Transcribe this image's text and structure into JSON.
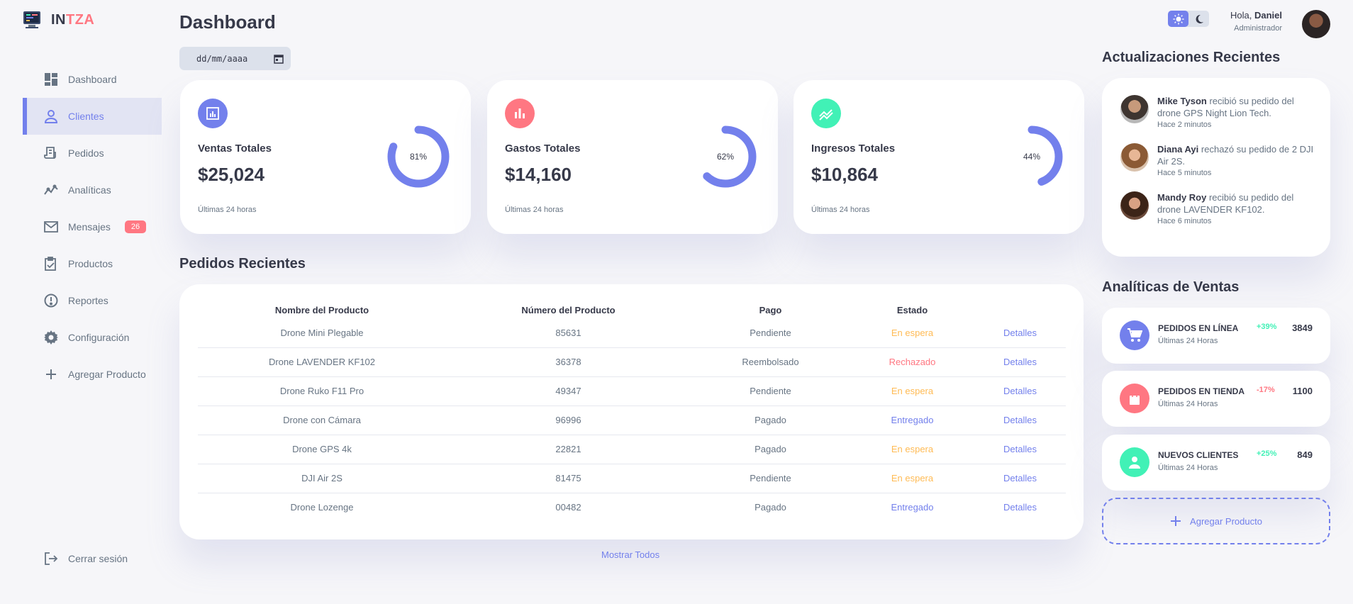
{
  "brand": {
    "prefix": "IN",
    "accent": "TZA"
  },
  "sidebar": {
    "items": [
      {
        "label": "Dashboard",
        "icon": "grid-icon",
        "active": false
      },
      {
        "label": "Clientes",
        "icon": "person-icon",
        "active": true
      },
      {
        "label": "Pedidos",
        "icon": "receipt-icon",
        "active": false
      },
      {
        "label": "Analíticas",
        "icon": "analytics-icon",
        "active": false
      },
      {
        "label": "Mensajes",
        "icon": "mail-icon",
        "active": false,
        "badge": "26"
      },
      {
        "label": "Productos",
        "icon": "inventory-icon",
        "active": false
      },
      {
        "label": "Reportes",
        "icon": "report-icon",
        "active": false
      },
      {
        "label": "Configuración",
        "icon": "gear-icon",
        "active": false
      },
      {
        "label": "Agregar Producto",
        "icon": "plus-icon",
        "active": false
      }
    ],
    "logout": "Cerrar sesión"
  },
  "header": {
    "title": "Dashboard",
    "date_placeholder": "dd/mm/aaaa",
    "greeting": "Hola,",
    "user_name": "Daniel",
    "user_role": "Administrador"
  },
  "insights": [
    {
      "label": "Ventas Totales",
      "value": "$25,024",
      "percent": "81%",
      "fraction": 0.81,
      "footer": "Últimas 24 horas",
      "icon": "analytics-icon",
      "color": "#7380ec"
    },
    {
      "label": "Gastos Totales",
      "value": "$14,160",
      "percent": "62%",
      "fraction": 0.62,
      "footer": "Últimas 24 horas",
      "icon": "bar-chart-icon",
      "color": "#ff7782"
    },
    {
      "label": "Ingresos Totales",
      "value": "$10,864",
      "percent": "44%",
      "fraction": 0.44,
      "footer": "Últimas 24 horas",
      "icon": "trend-icon",
      "color": "#41f1b6"
    }
  ],
  "orders": {
    "title": "Pedidos Recientes",
    "columns": [
      "Nombre del Producto",
      "Número del Producto",
      "Pago",
      "Estado",
      ""
    ],
    "rows": [
      {
        "name": "Drone Mini Plegable",
        "number": "85631",
        "payment": "Pendiente",
        "status": "En espera",
        "status_type": "warn",
        "action": "Detalles"
      },
      {
        "name": "Drone LAVENDER KF102",
        "number": "36378",
        "payment": "Reembolsado",
        "status": "Rechazado",
        "status_type": "danger",
        "action": "Detalles"
      },
      {
        "name": "Drone Ruko F11 Pro",
        "number": "49347",
        "payment": "Pendiente",
        "status": "En espera",
        "status_type": "warn",
        "action": "Detalles"
      },
      {
        "name": "Drone con Cámara",
        "number": "96996",
        "payment": "Pagado",
        "status": "Entregado",
        "status_type": "primary",
        "action": "Detalles"
      },
      {
        "name": "Drone GPS 4k",
        "number": "22821",
        "payment": "Pagado",
        "status": "En espera",
        "status_type": "warn",
        "action": "Detalles"
      },
      {
        "name": "DJI Air 2S",
        "number": "81475",
        "payment": "Pendiente",
        "status": "En espera",
        "status_type": "warn",
        "action": "Detalles"
      },
      {
        "name": "Drone Lozenge",
        "number": "00482",
        "payment": "Pagado",
        "status": "Entregado",
        "status_type": "primary",
        "action": "Detalles"
      }
    ],
    "show_all": "Mostrar Todos"
  },
  "updates": {
    "title": "Actualizaciones Recientes",
    "items": [
      {
        "name": "Mike Tyson",
        "text": "recibió su pedido del drone GPS Night Lion Tech.",
        "time": "Hace 2 minutos"
      },
      {
        "name": "Diana Ayi",
        "text": "rechazó su pedido de 2 DJI Air 2S.",
        "time": "Hace 5 minutos"
      },
      {
        "name": "Mandy Roy",
        "text": "recibió su pedido del drone LAVENDER KF102.",
        "time": "Hace 6 minutos"
      }
    ]
  },
  "sales_analytics": {
    "title": "Analíticas de Ventas",
    "items": [
      {
        "label": "PEDIDOS EN LÍNEA",
        "sub": "Últimas 24 Horas",
        "pct": "+39%",
        "value": "3849",
        "icon": "cart-icon",
        "color": "#7380ec",
        "trend": "pos"
      },
      {
        "label": "PEDIDOS EN TIENDA",
        "sub": "Últimas 24 Horas",
        "pct": "-17%",
        "value": "1100",
        "icon": "shopping-bag-icon",
        "color": "#ff7782",
        "trend": "neg"
      },
      {
        "label": "NUEVOS CLIENTES",
        "sub": "Últimas 24 Horas",
        "pct": "+25%",
        "value": "849",
        "icon": "person-icon",
        "color": "#41f1b6",
        "trend": "pos"
      }
    ],
    "add_product": "Agregar Producto"
  }
}
